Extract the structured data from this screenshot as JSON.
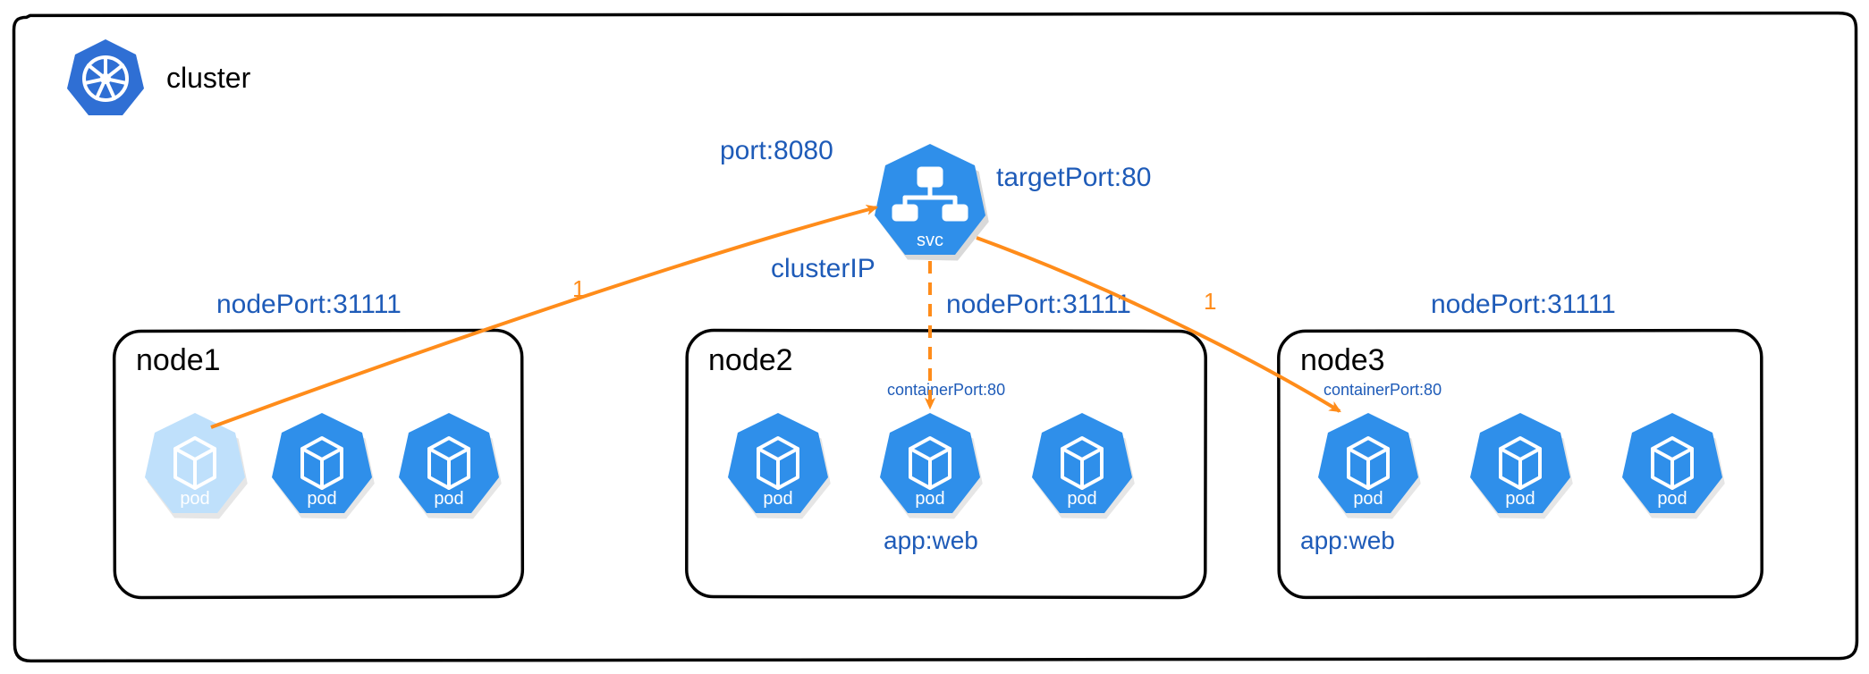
{
  "cluster": {
    "label": "cluster"
  },
  "service": {
    "badge": "svc",
    "port_label": "port:8080",
    "target_port_label": "targetPort:80",
    "cluster_ip_label": "clusterIP"
  },
  "nodes": [
    {
      "name": "node1",
      "nodeport_label": "nodePort:31111",
      "pods": [
        {
          "label": "pod",
          "faded": true
        },
        {
          "label": "pod",
          "faded": false
        },
        {
          "label": "pod",
          "faded": false
        }
      ]
    },
    {
      "name": "node2",
      "nodeport_label": "nodePort:31111",
      "container_port_label": "containerPort:80",
      "app_label": "app:web",
      "pods": [
        {
          "label": "pod",
          "faded": false
        },
        {
          "label": "pod",
          "faded": false
        },
        {
          "label": "pod",
          "faded": false
        }
      ]
    },
    {
      "name": "node3",
      "nodeport_label": "nodePort:31111",
      "container_port_label": "containerPort:80",
      "app_label": "app:web",
      "pods": [
        {
          "label": "pod",
          "faded": false
        },
        {
          "label": "pod",
          "faded": false
        },
        {
          "label": "pod",
          "faded": false
        }
      ]
    }
  ],
  "arrows": {
    "edge_label_1": "1",
    "edge_label_2": "1"
  }
}
